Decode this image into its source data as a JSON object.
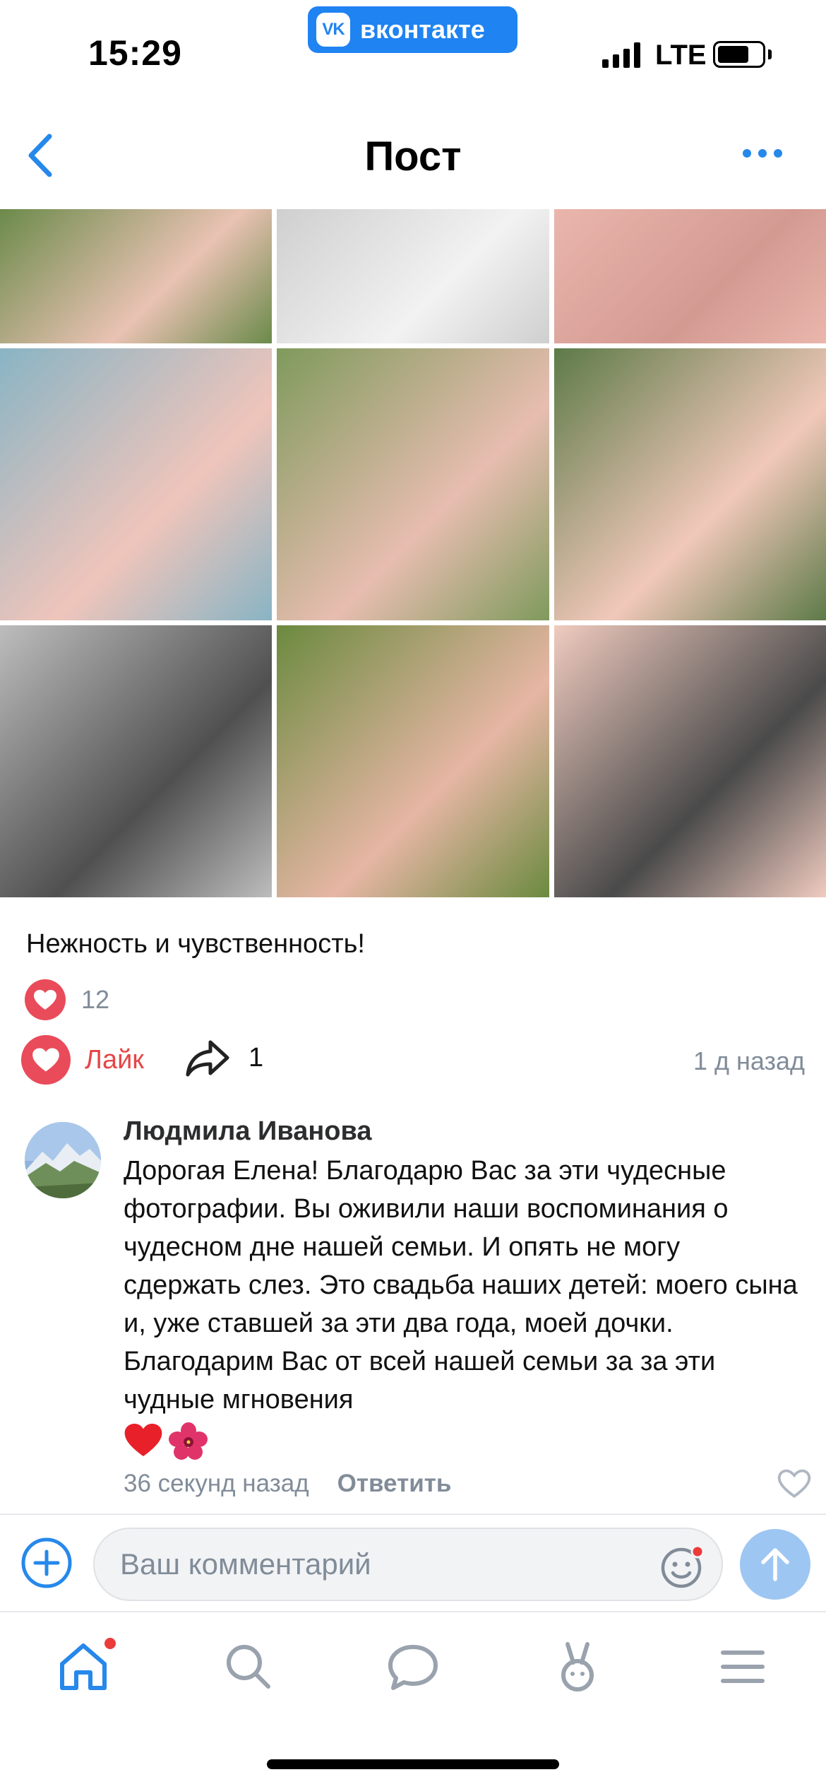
{
  "status_bar": {
    "time": "15:29",
    "app_pill": "вконтакте",
    "app_pill_logo": "VK",
    "network": "LTE",
    "battery_level": 0.72
  },
  "header": {
    "title": "Пост",
    "back_icon": "chevron-left-icon",
    "more_icon": "more-dots-icon"
  },
  "photos": [
    {
      "name": "couple-bouquet-dress",
      "tone": [
        "#6b8a4a",
        "#e9c2b3"
      ]
    },
    {
      "name": "tulle-bw",
      "tone": [
        "#cfcfcf",
        "#f2f2f2"
      ]
    },
    {
      "name": "pink-dress-corset",
      "tone": [
        "#eab6ac",
        "#d39a92"
      ]
    },
    {
      "name": "bride-shoes-pier",
      "tone": [
        "#89b4c4",
        "#efc5bb"
      ]
    },
    {
      "name": "couple-walking-park",
      "tone": [
        "#7f9a5c",
        "#e7bdb0"
      ]
    },
    {
      "name": "bride-by-pond",
      "tone": [
        "#5d7a48",
        "#f1c8ba"
      ]
    },
    {
      "name": "couple-kiss-bw",
      "tone": [
        "#bdbdbd",
        "#505050"
      ]
    },
    {
      "name": "couple-embrace-garden",
      "tone": [
        "#6b8a3f",
        "#e6b6a4"
      ]
    },
    {
      "name": "hands-sleeve-detail",
      "tone": [
        "#f0cbbf",
        "#4a4a4a"
      ]
    }
  ],
  "post": {
    "caption": "Нежность и чувственность!",
    "likes_count": "12",
    "like_label": "Лайк",
    "shares_count": "1",
    "time": "1 д назад"
  },
  "comment": {
    "author": "Людмила Иванова",
    "text": "Дорогая Елена! Благодарю Вас за эти чудесные фотографии. Вы оживили наши воспоминания о чудесном дне нашей семьи. И опять не могу сдержать слез. Это свадьба наших детей: моего сына и, уже ставшей за эти два года, моей дочки. Благодарим Вас от всей нашей семьи за за эти чудные мгновения",
    "emoji": [
      "❤️",
      "🌺"
    ],
    "time": "36 секунд назад",
    "reply_label": "Ответить"
  },
  "composer": {
    "placeholder": "Ваш комментарий"
  },
  "tabs": [
    {
      "name": "home-icon",
      "active": true,
      "badge": true
    },
    {
      "name": "search-icon",
      "active": false
    },
    {
      "name": "messages-icon",
      "active": false
    },
    {
      "name": "clips-icon",
      "active": false
    },
    {
      "name": "menu-icon",
      "active": false
    }
  ],
  "colors": {
    "accent": "#2688eb",
    "like": "#e64646",
    "secondary_text": "#818c99",
    "vk_blue": "#1f83f2"
  }
}
